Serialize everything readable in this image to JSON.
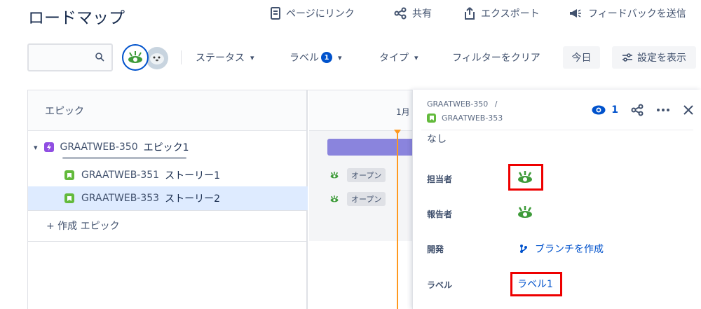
{
  "header": {
    "title": "ロードマップ",
    "links": {
      "page_link": "ページにリンク",
      "share": "共有",
      "export": "エクスポート",
      "feedback": "フィードバックを送信"
    }
  },
  "toolbar": {
    "search_placeholder": "",
    "filters": {
      "status": "ステータス",
      "label": "ラベル",
      "label_count": "1",
      "type": "タイプ",
      "clear": "フィルターをクリア"
    },
    "today": "今日",
    "settings": "設定を表示"
  },
  "roadmap": {
    "column_header": "エピック",
    "month": "1月",
    "epic": {
      "key": "GRAATWEB-350",
      "summary": "エピック1"
    },
    "stories": [
      {
        "key": "GRAATWEB-351",
        "summary": "ストーリー1",
        "status": "オープン"
      },
      {
        "key": "GRAATWEB-353",
        "summary": "ストーリー2",
        "status": "オープン"
      }
    ],
    "create_epic": "+ 作成 エピック"
  },
  "panel": {
    "breadcrumb_parent": "GRAATWEB-350",
    "breadcrumb_separator": "/",
    "issue_key": "GRAATWEB-353",
    "watch_count": "1",
    "truncated_value": "なし",
    "fields": {
      "assignee_label": "担当者",
      "reporter_label": "報告者",
      "development_label": "開発",
      "create_branch": "ブランチを作成",
      "labels_label": "ラベル",
      "label_value": "ラベル1"
    }
  },
  "colors": {
    "accent": "#0052cc",
    "epic": "#904ee2",
    "story": "#63ba3c",
    "today_line": "#ff991f",
    "highlight": "#ee0000"
  }
}
